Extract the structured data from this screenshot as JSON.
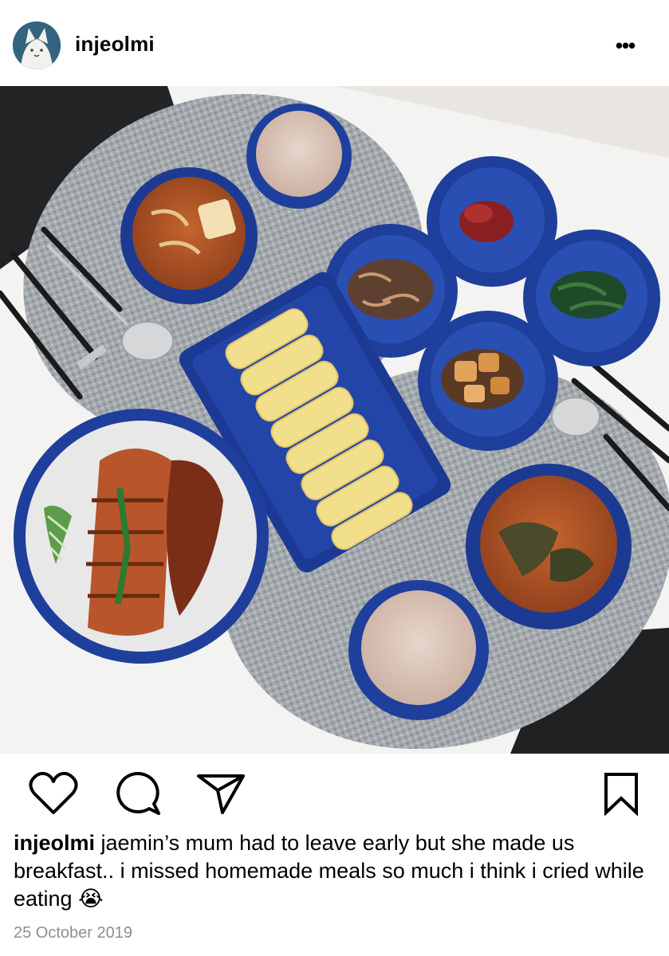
{
  "post": {
    "username": "injeolmi",
    "more_label": "•••",
    "caption": {
      "username": "injeolmi",
      "text": "jaemin’s mum had to leave early but she made us breakfast.. i missed homemade meals so much i think i cried while eating 😭"
    },
    "date": "25 October 2019"
  },
  "icons": {
    "like": "heart-icon",
    "comment": "speech-bubble-icon",
    "share": "paper-plane-icon",
    "save": "bookmark-icon",
    "more": "three-dots-icon"
  },
  "colors": {
    "date_gray": "#8e8e8e",
    "bowl_blue": "#1f3f9c",
    "placemat_gray": "#9aa0a7"
  }
}
